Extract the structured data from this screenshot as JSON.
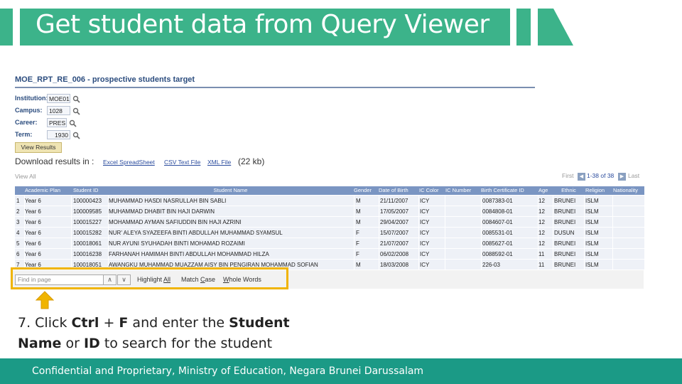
{
  "slide": {
    "title": "Get student data from Query Viewer",
    "footer": "Confidential and Proprietary, Ministry of Education, Negara Brunei Darussalam",
    "accent_color": "#3cb38a",
    "footer_color": "#1b9a86",
    "highlight_color": "#f0b400"
  },
  "report": {
    "title": "MOE_RPT_RE_006 - prospective students target",
    "params": [
      {
        "label": "Institution:",
        "value": "MOE01"
      },
      {
        "label": "Campus:",
        "value": "1028"
      },
      {
        "label": "Career:",
        "value": "PRES"
      },
      {
        "label": "Term:",
        "value": "1930"
      }
    ],
    "view_results_label": "View Results",
    "download_label": "Download results in :",
    "download_links": [
      "Excel SpreadSheet",
      "CSV Text File",
      "XML File"
    ],
    "download_size": "(22 kb)",
    "view_all": "View All",
    "pager": {
      "first": "First",
      "count": "1-38 of 38",
      "last": "Last"
    },
    "columns": [
      "Academic Plan",
      "Student ID",
      "Student Name",
      "Gender",
      "Date of Birth",
      "IC Color",
      "IC Number",
      "Birth Certificate ID",
      "Age",
      "Ethnic",
      "Religion",
      "Nationality"
    ],
    "rows": [
      [
        "1",
        "Year 6",
        "100000423",
        "MUHAMMAD HASDI NASRULLAH BIN SABLI",
        "M",
        "21/11/2007",
        "ICY",
        "",
        "0087383-01",
        "12",
        "BRUNEI",
        "ISLM",
        ""
      ],
      [
        "2",
        "Year 6",
        "100009585",
        "MUHAMMAD DHABIT BIN HAJI DARWIN",
        "M",
        "17/05/2007",
        "ICY",
        "",
        "0084808-01",
        "12",
        "BRUNEI",
        "ISLM",
        ""
      ],
      [
        "3",
        "Year 6",
        "100015227",
        "MOHAMMAD AYMAN SAFIUDDIN BIN HAJI AZRINI",
        "M",
        "29/04/2007",
        "ICY",
        "",
        "0084607-01",
        "12",
        "BRUNEI",
        "ISLM",
        ""
      ],
      [
        "4",
        "Year 6",
        "100015282",
        "NUR' ALEYA SYAZEEFA BINTI ABDULLAH MUHAMMAD SYAMSUL",
        "F",
        "15/07/2007",
        "ICY",
        "",
        "0085531-01",
        "12",
        "DUSUN",
        "ISLM",
        ""
      ],
      [
        "5",
        "Year 6",
        "100018061",
        "NUR AYUNI SYUHADAH BINTI MOHAMAD ROZAIMI",
        "F",
        "21/07/2007",
        "ICY",
        "",
        "0085627-01",
        "12",
        "BRUNEI",
        "ISLM",
        ""
      ],
      [
        "6",
        "Year 6",
        "100016238",
        "FARHANAH HAMIMAH BINTI ABDULLAH MOHAMMAD HILZA",
        "F",
        "06/02/2008",
        "ICY",
        "",
        "0088592-01",
        "11",
        "BRUNEI",
        "ISLM",
        ""
      ],
      [
        "7",
        "Year 6",
        "100018051",
        "AWANGKU MUHAMMAD MUAZZAM AISY BIN PENGIRAN MOHAMMAD SOFIAN",
        "M",
        "18/03/2008",
        "ICY",
        "",
        "226-03",
        "11",
        "BRUNEI",
        "ISLM",
        ""
      ]
    ]
  },
  "findbar": {
    "placeholder": "Find in page",
    "up": "∧",
    "down": "∨",
    "highlight_all_pre": "Highlight ",
    "highlight_all_ul": "All",
    "match_case_pre": "Match ",
    "match_case_ul": "C",
    "match_case_post": "ase",
    "whole_words_ul": "W",
    "whole_words_post": "hole Words"
  },
  "instruction": {
    "p1": "7. Click ",
    "ctrl": "Ctrl",
    "p2": " + ",
    "f": "F",
    "p3": " and enter the ",
    "student": "Student",
    "name": "Name",
    "p4": " or ",
    "id": "ID",
    "p5": " to search for the student"
  }
}
